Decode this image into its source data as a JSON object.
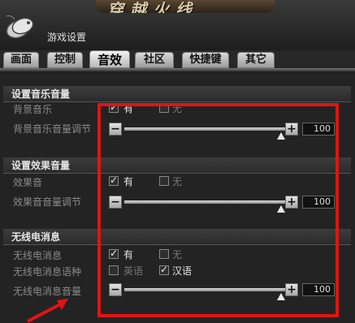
{
  "window": {
    "title": "游戏设置"
  },
  "logo": {
    "text": "穿越火线"
  },
  "tabs": [
    {
      "label": "画面"
    },
    {
      "label": "控制"
    },
    {
      "label": "音效",
      "active": true
    },
    {
      "label": "社区"
    },
    {
      "label": "快捷键"
    },
    {
      "label": "其它"
    }
  ],
  "sections": {
    "music": {
      "title": "设置音乐音量",
      "toggle_label": "背景音乐",
      "opt_on": "有",
      "opt_off": "无",
      "slider_label": "背景音乐音量调节",
      "value": "100"
    },
    "effect": {
      "title": "设置效果音量",
      "toggle_label": "效果音",
      "opt_on": "有",
      "opt_off": "无",
      "slider_label": "效果音音量调节",
      "value": "100"
    },
    "radio": {
      "title": "无线电消息",
      "toggle_label": "无线电消息",
      "opt_on": "有",
      "opt_off": "无",
      "lang_label": "无线电消息语种",
      "lang_en": "英语",
      "lang_cn": "汉语",
      "slider_label": "无线电消息音量",
      "value": "100"
    }
  },
  "colors": {
    "highlight": "#e01414"
  }
}
